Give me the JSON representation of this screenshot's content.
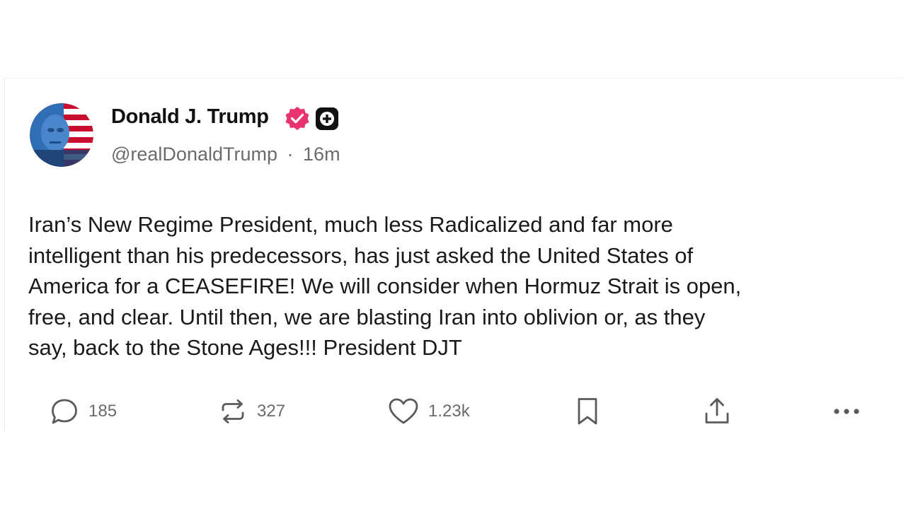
{
  "post": {
    "author": {
      "name": "Donald J. Trump",
      "handle": "@realDonaldTrump",
      "separator": "·",
      "time": "16m",
      "verified": true,
      "avatar_icon": "flag-portrait-avatar"
    },
    "text_lines": [
      "Iran’s New Regime President, much less Radicalized and far more",
      "intelligent than his predecessors, has just asked the United States of",
      "America for a CEASEFIRE! We will consider when Hormuz Strait is open,",
      "free, and clear. Until then, we are blasting Iran into oblivion or, as they",
      "say, back to the Stone Ages!!! President DJT"
    ],
    "actions": {
      "replies": {
        "icon": "reply-icon",
        "count": "185"
      },
      "reposts": {
        "icon": "repost-icon",
        "count": "327"
      },
      "likes": {
        "icon": "heart-icon",
        "count": "1.23k"
      },
      "bookmark": {
        "icon": "bookmark-icon"
      },
      "share": {
        "icon": "share-icon"
      },
      "more": {
        "icon": "more-icon"
      }
    }
  },
  "colors": {
    "verified_badge": "#e8336f",
    "plus_badge": "#111111",
    "muted_text": "#6b6b6b",
    "flag_red": "#c8102e",
    "flag_blue": "#2f6db5"
  }
}
